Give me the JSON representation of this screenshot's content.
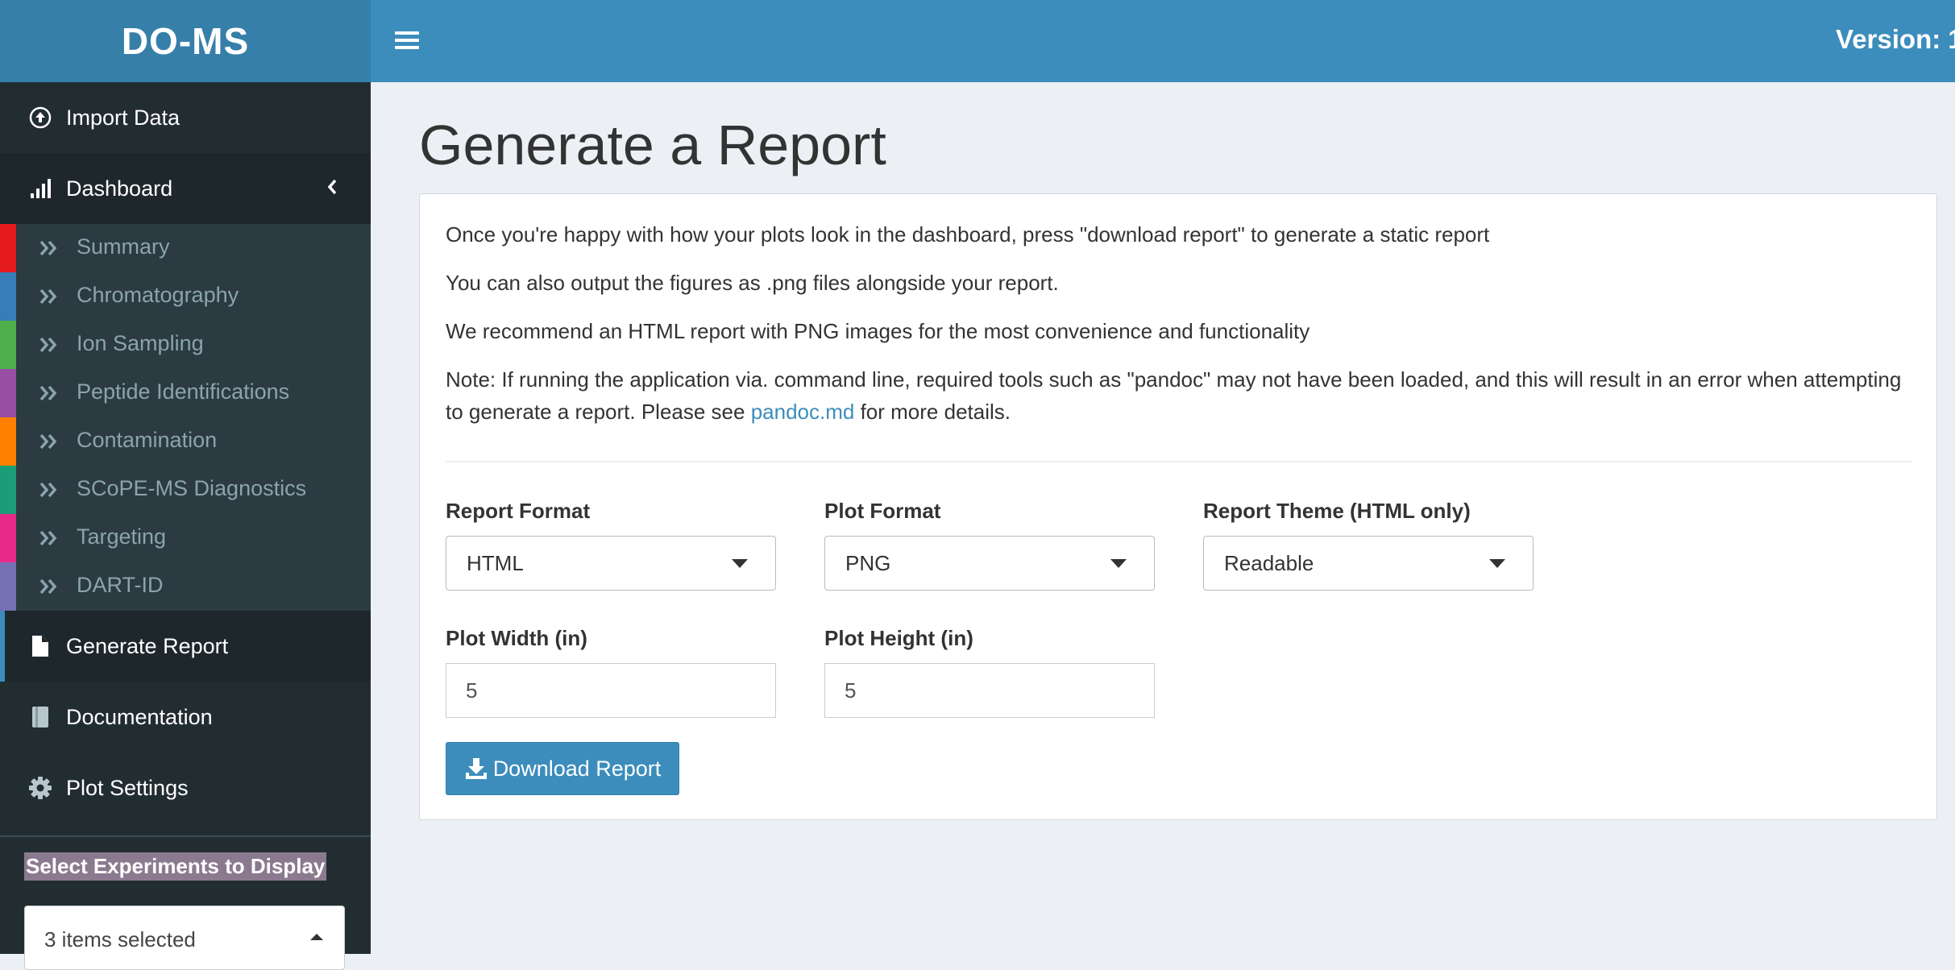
{
  "header": {
    "logo": "DO-MS",
    "version": "Version: 1."
  },
  "sidebar": {
    "import_data": "Import Data",
    "dashboard": "Dashboard",
    "dashboard_items": [
      {
        "label": "Summary",
        "color": "#e41a1c"
      },
      {
        "label": "Chromatography",
        "color": "#377eb8"
      },
      {
        "label": "Ion Sampling",
        "color": "#4daf4a"
      },
      {
        "label": "Peptide Identifications",
        "color": "#984ea3"
      },
      {
        "label": "Contamination",
        "color": "#ff7f00"
      },
      {
        "label": "SCoPE-MS Diagnostics",
        "color": "#1b9e77"
      },
      {
        "label": "Targeting",
        "color": "#e7298a"
      },
      {
        "label": "DART-ID",
        "color": "#7570b3"
      }
    ],
    "generate_report": "Generate Report",
    "documentation": "Documentation",
    "plot_settings": "Plot Settings",
    "experiments_label": "Select Experiments to Display",
    "experiments_selected": "3 items selected"
  },
  "main": {
    "title": "Generate a Report",
    "paragraphs": {
      "p1": "Once you're happy with how your plots look in the dashboard, press \"download report\" to generate a static report",
      "p2": "You can also output the figures as .png files alongside your report.",
      "p3": "We recommend an HTML report with PNG images for the most convenience and functionality",
      "p4_before": "Note: If running the application via. command line, required tools such as \"pandoc\" may not have been loaded, and this will result in an error when attempting to generate a report. Please see ",
      "p4_link": "pandoc.md",
      "p4_after": " for more details."
    },
    "report_format": {
      "label": "Report Format",
      "value": "HTML"
    },
    "plot_format": {
      "label": "Plot Format",
      "value": "PNG"
    },
    "report_theme": {
      "label": "Report Theme (HTML only)",
      "value": "Readable"
    },
    "plot_width": {
      "label": "Plot Width (in)",
      "value": "5"
    },
    "plot_height": {
      "label": "Plot Height (in)",
      "value": "5"
    },
    "download_button": "Download Report"
  },
  "colors": {
    "header": "#3c8dbc",
    "logo_bg": "#367fa9",
    "sidebar_bg": "#222d32",
    "submenu_bg": "#2c3b41",
    "content_bg": "#ecf0f5"
  }
}
